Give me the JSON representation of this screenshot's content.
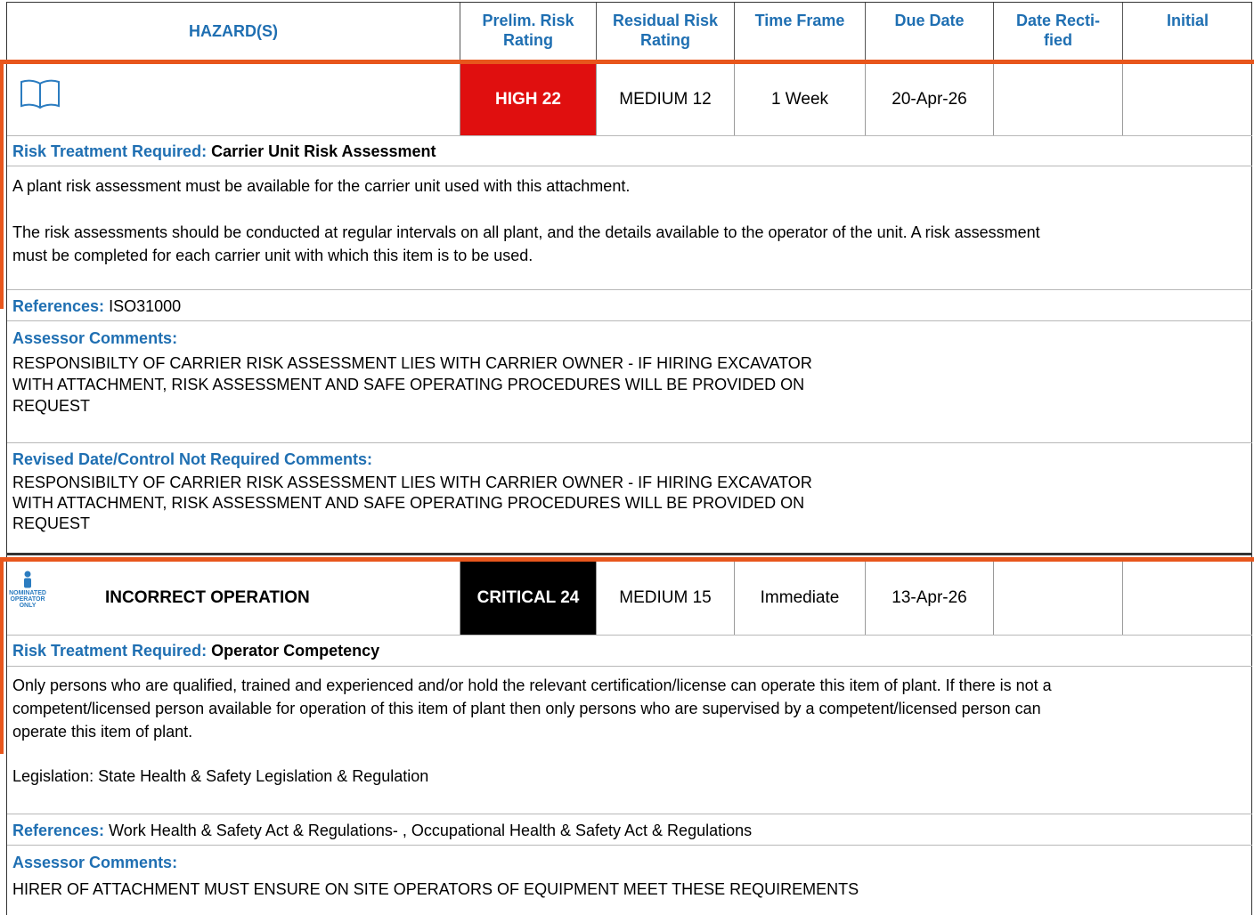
{
  "header": {
    "hazards": "HAZARD(S)",
    "prelim_l1": "Prelim. Risk",
    "prelim_l2": "Rating",
    "residual_l1": "Residual Risk",
    "residual_l2": "Rating",
    "time_frame": "Time Frame",
    "due_date": "Due Date",
    "rectified_l1": "Date Recti-",
    "rectified_l2": "fied",
    "initial": "Initial"
  },
  "colors": {
    "accent": "#1f6fb2",
    "orange": "#e8561c",
    "high": "#e00f0f",
    "critical": "#000000"
  },
  "hazards": [
    {
      "icon": "book-icon",
      "name": "",
      "prelim": "HIGH 22",
      "residual": "MEDIUM 12",
      "time_frame": "1 Week",
      "due_date": "20-Apr-26",
      "rectified": "",
      "initial": "",
      "treatment_label": "Risk Treatment Required:",
      "treatment": "Carrier Unit Risk Assessment",
      "desc_1": "A plant risk assessment must be available for the carrier unit used with this attachment.",
      "desc_2a": "The risk assessments should be conducted at regular intervals on all plant, and the details available to the operator of the unit. A risk assessment",
      "desc_2b": "must be completed for each carrier unit with which this item is to be used.",
      "references_label": "References:",
      "references": "ISO31000",
      "assessor_label": "Assessor Comments:",
      "assessor_1": "RESPONSIBILTY OF CARRIER RISK ASSESSMENT LIES WITH CARRIER OWNER - IF HIRING EXCAVATOR",
      "assessor_2": "WITH ATTACHMENT, RISK ASSESSMENT AND SAFE OPERATING PROCEDURES WILL BE PROVIDED ON",
      "assessor_3": "REQUEST",
      "revised_label": "Revised Date/Control Not Required Comments:",
      "revised_1": "RESPONSIBILTY OF CARRIER RISK ASSESSMENT LIES WITH CARRIER OWNER - IF HIRING EXCAVATOR",
      "revised_2": "WITH ATTACHMENT, RISK ASSESSMENT AND SAFE OPERATING PROCEDURES WILL BE PROVIDED ON",
      "revised_3": "REQUEST"
    },
    {
      "icon": "nominated-operator-icon",
      "icon_text_1": "NOMINATED",
      "icon_text_2": "OPERATOR",
      "icon_text_3": "ONLY",
      "name": "INCORRECT OPERATION",
      "prelim": "CRITICAL 24",
      "residual": "MEDIUM 15",
      "time_frame": "Immediate",
      "due_date": "13-Apr-26",
      "rectified": "",
      "initial": "",
      "treatment_label": "Risk Treatment Required:",
      "treatment": "Operator Competency",
      "desc_1": "Only persons who are qualified, trained and experienced and/or hold the relevant certification/license can operate this item of plant. If there is not a",
      "desc_2": "competent/licensed person available for operation of this item of plant then only persons who are supervised by a competent/licensed person can",
      "desc_3": "operate this item of plant.",
      "legislation": "Legislation: State Health & Safety Legislation & Regulation",
      "references_label": "References:",
      "references": "Work Health & Safety Act & Regulations- , Occupational Health & Safety Act & Regulations",
      "assessor_label": "Assessor Comments:",
      "assessor_1": "HIRER OF ATTACHMENT MUST ENSURE ON SITE OPERATORS OF EQUIPMENT MEET THESE REQUIREMENTS"
    }
  ]
}
